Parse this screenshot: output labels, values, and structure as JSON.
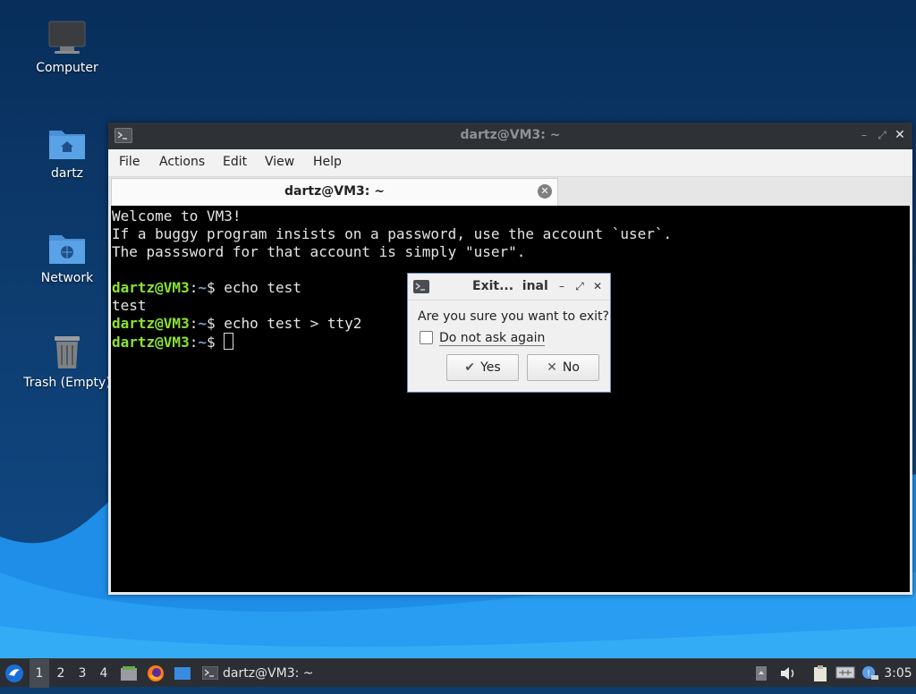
{
  "desktop": {
    "icons": [
      {
        "label": "Computer",
        "icon": "computer-icon"
      },
      {
        "label": "dartz",
        "icon": "home-folder-icon"
      },
      {
        "label": "Network",
        "icon": "network-folder-icon"
      },
      {
        "label": "Trash (Empty)",
        "icon": "trash-icon"
      }
    ]
  },
  "terminal_window": {
    "title": "dartz@VM3: ~",
    "menu": [
      "File",
      "Actions",
      "Edit",
      "View",
      "Help"
    ],
    "tab_title": "dartz@VM3: ~",
    "lines": [
      "Welcome to VM3!",
      "If a buggy program insists on a password, use the account `user`.",
      "The passsword for that account is simply \"user\".",
      ""
    ],
    "prompt_user": "dartz@VM3",
    "prompt_sep": ":",
    "prompt_path": "~",
    "prompt_symbol": "$ ",
    "history": [
      {
        "command": "echo test",
        "output": "test"
      },
      {
        "command": "echo test > tty2",
        "output": null
      },
      {
        "command": "",
        "output": null
      }
    ]
  },
  "dialog": {
    "title": "Exit...  inal",
    "message": "Are you sure you want to exit?",
    "checkbox_label": "Do not ask again",
    "checkbox_checked": false,
    "yes_label": "Yes",
    "no_label": "No"
  },
  "taskbar": {
    "workspaces": [
      "1",
      "2",
      "3",
      "4"
    ],
    "active_workspace": "1",
    "task_label": "dartz@VM3: ~",
    "clock": "3:05",
    "accent": "#1a6fd6"
  }
}
